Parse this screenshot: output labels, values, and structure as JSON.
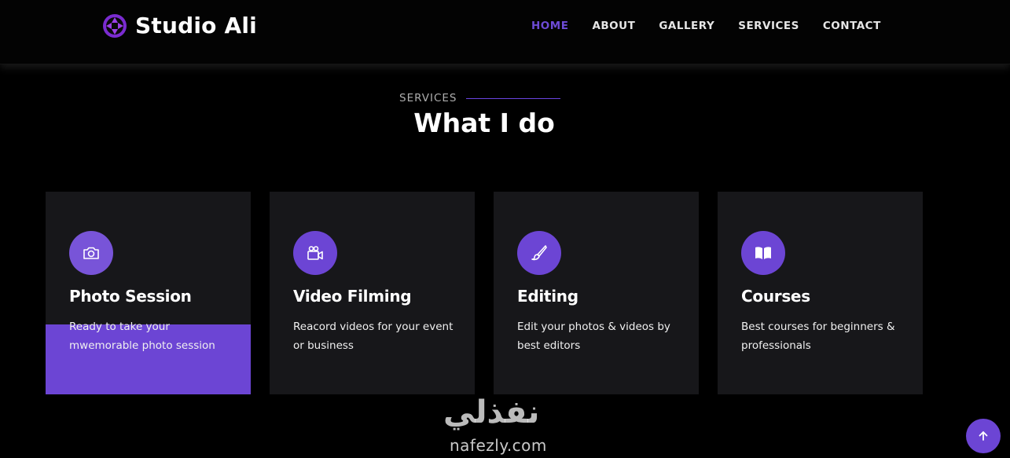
{
  "header": {
    "brand_name": "Studio Ali",
    "logo_icon": "aperture-icon",
    "nav": [
      {
        "label": "HOME",
        "active": true
      },
      {
        "label": "ABOUT",
        "active": false
      },
      {
        "label": "GALLERY",
        "active": false
      },
      {
        "label": "SERVICES",
        "active": false
      },
      {
        "label": "CONTACT",
        "active": false
      }
    ]
  },
  "section": {
    "label": "SERVICES",
    "title": "What I do"
  },
  "services": [
    {
      "icon": "camera-icon",
      "title": "Photo Session",
      "text": "Ready to take your mwemorable photo session",
      "active": true
    },
    {
      "icon": "video-camera-icon",
      "title": "Video Filming",
      "text": "Reacord videos for your event or business",
      "active": false
    },
    {
      "icon": "paintbrush-icon",
      "title": "Editing",
      "text": "Edit your photos & videos by best editors",
      "active": false
    },
    {
      "icon": "book-open-icon",
      "title": "Courses",
      "text": "Best courses for beginners & professionals",
      "active": false
    }
  ],
  "watermark": {
    "arabic": "نفذلي",
    "latin": "nafezly.com"
  },
  "back_to_top_icon": "arrow-up-icon",
  "colors": {
    "accent": "#6c45d4",
    "background": "#000000",
    "card": "#17171a"
  }
}
